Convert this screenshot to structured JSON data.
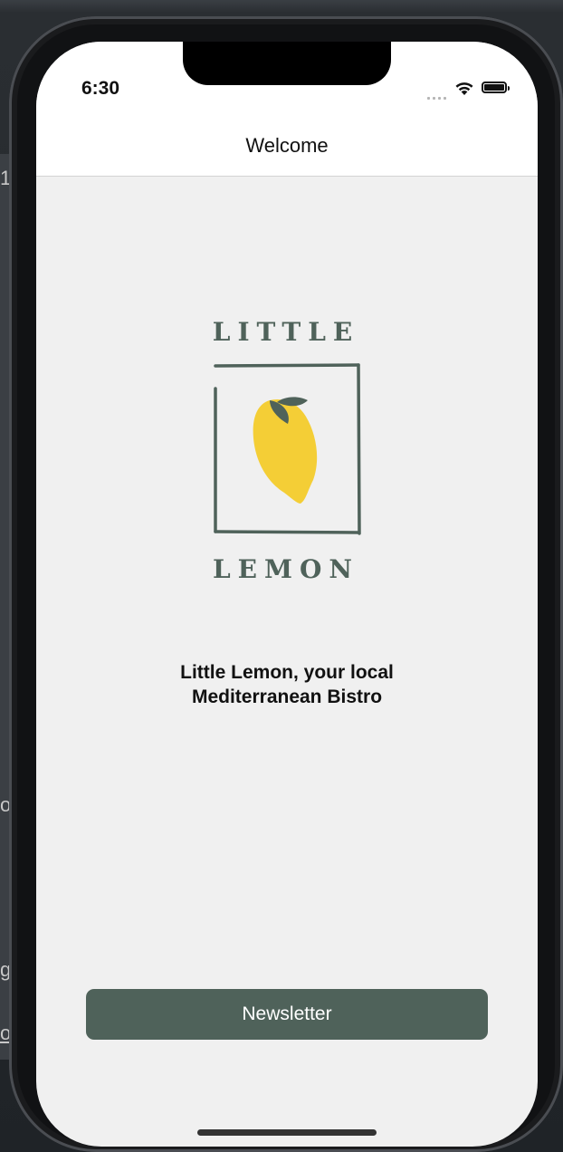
{
  "status_bar": {
    "time": "6:30"
  },
  "nav": {
    "title": "Welcome"
  },
  "logo": {
    "brand_top": "LITTLE",
    "brand_bottom": "LEMON",
    "colors": {
      "frame": "#4f625a",
      "lemon": "#f4ce36",
      "leaf": "#4f625a"
    }
  },
  "tagline": {
    "line1": "Little Lemon, your local",
    "line2": "Mediterranean Bistro"
  },
  "newsletter_button": {
    "label": "Newsletter",
    "color": "#4f625a"
  },
  "background_fragments": {
    "f1": "1",
    "f2": "o",
    "f3": "g",
    "f4": "o"
  }
}
